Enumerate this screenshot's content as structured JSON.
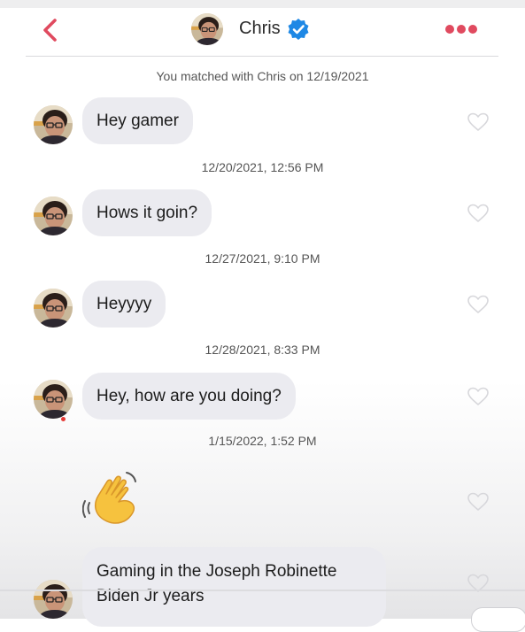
{
  "header": {
    "name": "Chris",
    "back_icon": "chevron-left-icon",
    "more_icon": "more-dots-icon",
    "verified_icon": "verified-badge-icon",
    "accent_color": "#e04a5f",
    "verified_color": "#1e88e5"
  },
  "match_note": "You matched with Chris on 12/19/2021",
  "messages": [
    {
      "text": "Hey gamer",
      "liked": false
    },
    {
      "text": "Hows it goin?",
      "liked": false
    },
    {
      "text": "Heyyyy",
      "liked": false
    },
    {
      "text": "Hey, how are you doing?",
      "liked": false
    },
    {
      "text": "👋",
      "liked": false
    },
    {
      "text": "Gaming in the Joseph Robinette Biden Jr years",
      "liked": false
    }
  ],
  "timestamps": [
    "12/20/2021, 12:56 PM",
    "12/27/2021, 9:10 PM",
    "12/28/2021, 8:33 PM",
    "1/15/2022, 1:52 PM"
  ]
}
